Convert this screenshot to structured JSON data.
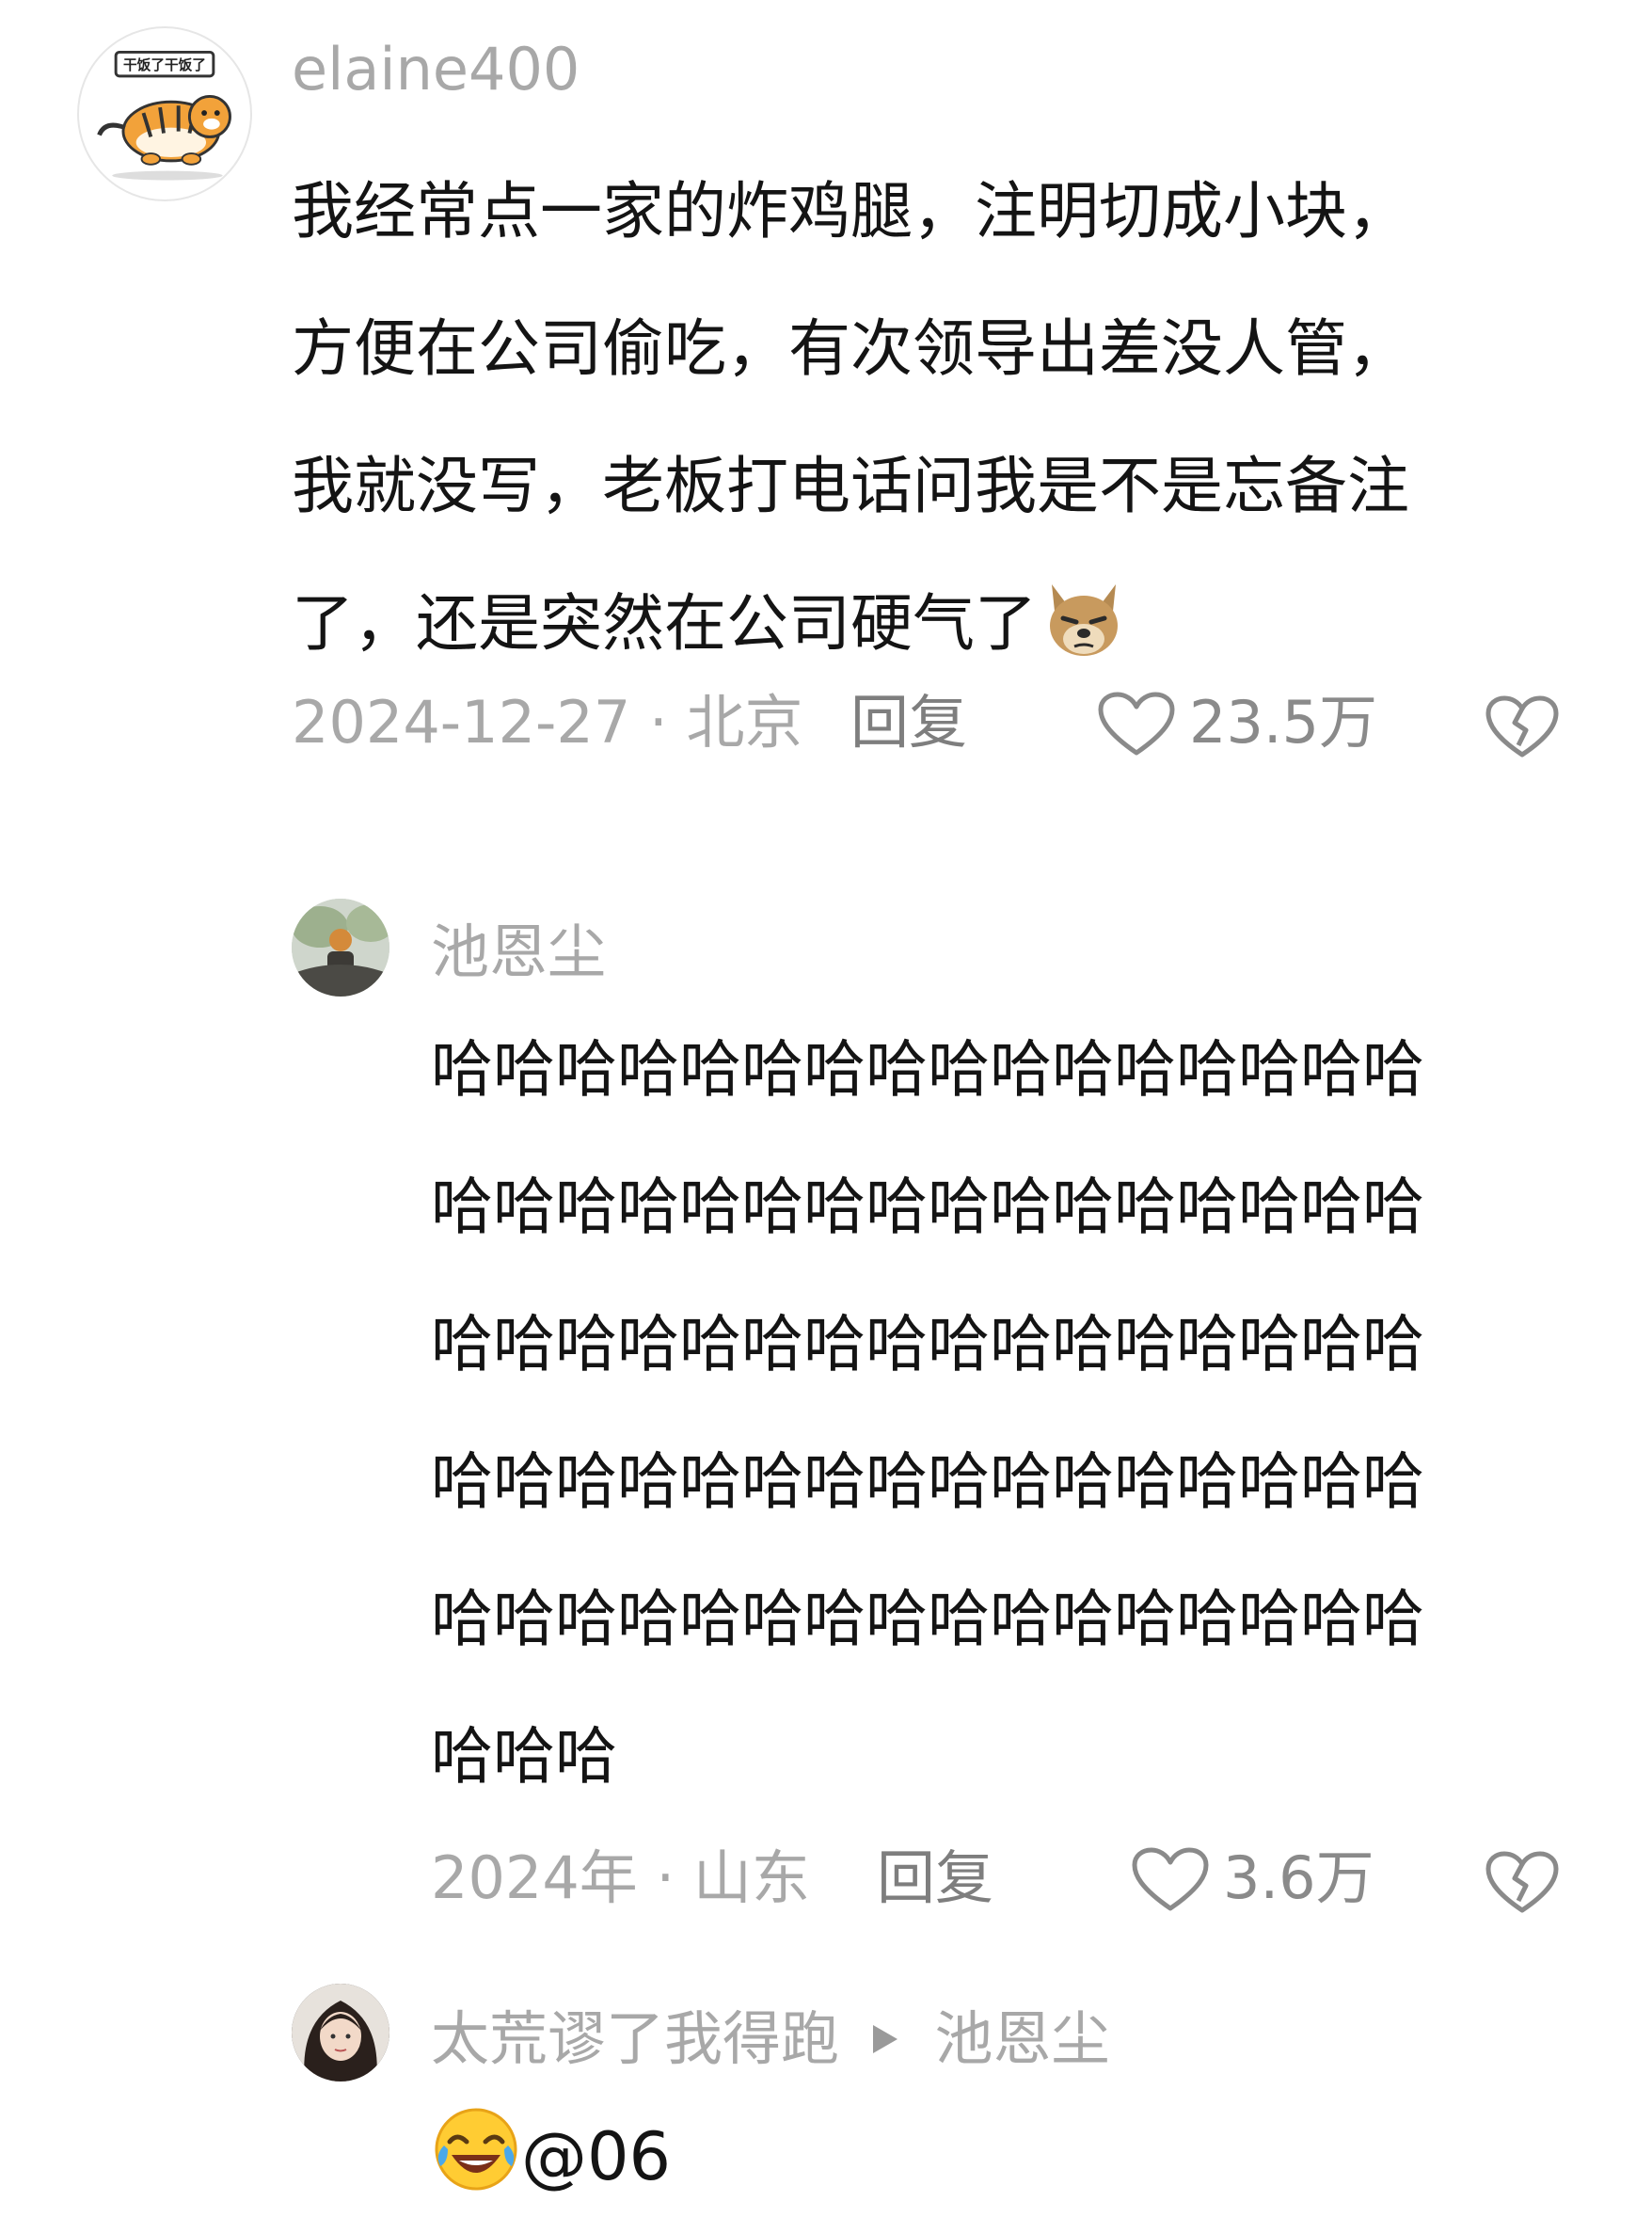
{
  "comments": [
    {
      "username": "elaine400",
      "avatar_icon": "tiger-sticker-avatar",
      "avatar_caption": "干饭了干饭了",
      "lines": [
        "我经常点一家的炸鸡腿，注明切成小块，",
        "方便在公司偷吃，有次领导出差没人管，",
        "我就没写，老板打电话问我是不是忘备注",
        "了，还是突然在公司硬气了"
      ],
      "trailing_emoji": "dog-smug-emoji",
      "date": "2024-12-27 · 北京",
      "reply_label": "回复",
      "likes": "23.5万",
      "like_icon": "heart-outline-icon",
      "dislike_icon": "broken-heart-icon"
    },
    {
      "username": "池恩尘",
      "avatar_icon": "photo-avatar",
      "lines": [
        "哈哈哈哈哈哈哈哈哈哈哈哈哈哈哈哈",
        "哈哈哈哈哈哈哈哈哈哈哈哈哈哈哈哈",
        "哈哈哈哈哈哈哈哈哈哈哈哈哈哈哈哈",
        "哈哈哈哈哈哈哈哈哈哈哈哈哈哈哈哈",
        "哈哈哈哈哈哈哈哈哈哈哈哈哈哈哈哈",
        "哈哈哈"
      ],
      "date": "2024年 · 山东",
      "reply_label": "回复",
      "likes": "3.6万",
      "like_icon": "heart-outline-icon",
      "dislike_icon": "broken-heart-icon"
    },
    {
      "username": "太荒谬了我得跑",
      "reply_arrow_icon": "play-triangle-icon",
      "reply_to": "池恩尘",
      "avatar_icon": "girl-photo-avatar",
      "leading_emoji": "laughing-crying-emoji",
      "text": "@06"
    }
  ],
  "colors": {
    "meta_text": "#a8a8a8",
    "body_text": "#141414",
    "icon_stroke": "#8a8a8a"
  }
}
